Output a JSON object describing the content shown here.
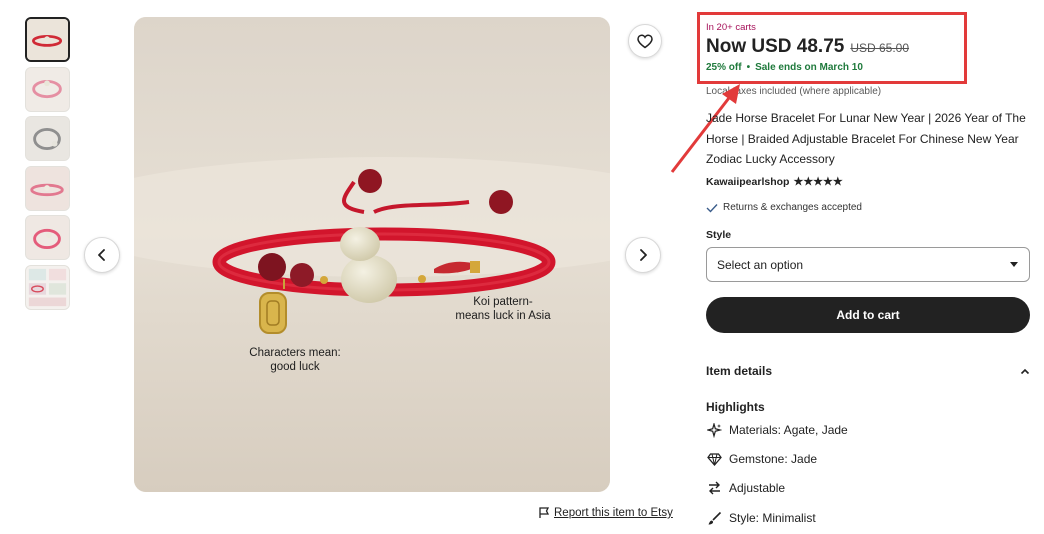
{
  "thumbnails": [
    {
      "name": "thumbnail-1",
      "active": true
    },
    {
      "name": "thumbnail-2",
      "active": false
    },
    {
      "name": "thumbnail-3",
      "active": false
    },
    {
      "name": "thumbnail-4",
      "active": false
    },
    {
      "name": "thumbnail-5",
      "active": false
    },
    {
      "name": "thumbnail-6",
      "active": false
    }
  ],
  "image_overlay": {
    "koi_line1": "Koi pattern-",
    "koi_line2": "means luck in Asia",
    "char_line1": "Characters mean:",
    "char_line2": "good luck"
  },
  "report_link": "Report this item to Etsy",
  "price": {
    "carts_badge": "In 20+ carts",
    "now": "Now USD 48.75",
    "original": "USD 65.00",
    "discount": "25% off",
    "separator": "•",
    "sale_ends": "Sale ends on March 10",
    "taxes_note": "Local taxes included (where applicable)"
  },
  "listing": {
    "title": "Jade Horse Bracelet For Lunar New Year | 2026 Year of The Horse | Braided Adjustable Bracelet For Chinese New Year Zodiac Lucky Accessory",
    "shop_name": "Kawaiipearlshop",
    "stars": "★★★★★",
    "returns": "Returns & exchanges accepted"
  },
  "options": {
    "style_label": "Style",
    "style_placeholder": "Select an option"
  },
  "cart": {
    "add_label": "Add to cart"
  },
  "details": {
    "section_label": "Item details",
    "highlights_label": "Highlights",
    "items": [
      {
        "icon": "sparkle-icon",
        "text": "Materials: Agate, Jade"
      },
      {
        "icon": "gem-icon",
        "text": "Gemstone: Jade"
      },
      {
        "icon": "adjust-arrows-icon",
        "text": "Adjustable"
      },
      {
        "icon": "brush-icon",
        "text": "Style: Minimalist"
      }
    ]
  },
  "colors": {
    "annotation_red": "#e23a3a",
    "carts_text": "#a6125a",
    "sale_green": "#1f7a3c",
    "button_dark": "#222222"
  }
}
